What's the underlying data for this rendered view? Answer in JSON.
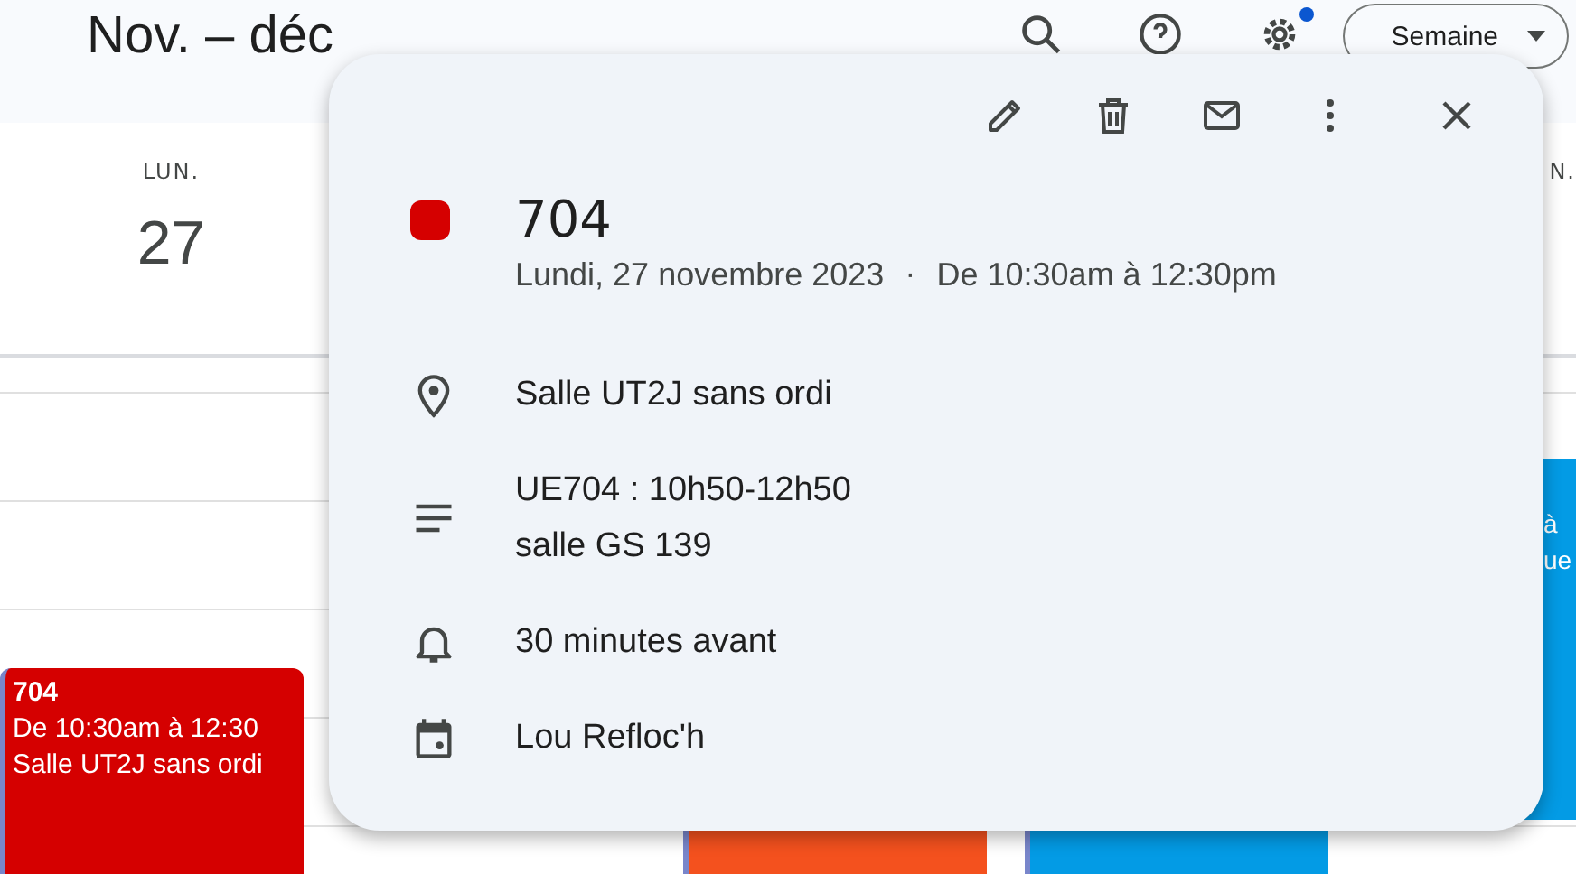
{
  "header": {
    "title": "Nov. – déc",
    "view_button": "Semaine",
    "settings_badge": true
  },
  "day_columns": [
    {
      "weekday": "LUN.",
      "day": "27"
    },
    {
      "weekday": "N."
    }
  ],
  "events": [
    {
      "color": "#d50000",
      "lines": [
        "704",
        "De 10:30am à 12:30",
        "Salle UT2J sans ordi"
      ]
    },
    {
      "color": "#f4511e"
    },
    {
      "color": "#039be5"
    },
    {
      "color": "#039be5",
      "lines": [
        "à",
        "ue"
      ]
    }
  ],
  "popup": {
    "color": "#d50000",
    "title": "704",
    "date": "Lundi, 27 novembre 2023",
    "separator": "·",
    "time": "De 10:30am à 12:30pm",
    "details": [
      {
        "kind": "location",
        "lines": [
          "Salle UT2J sans ordi"
        ]
      },
      {
        "kind": "description",
        "lines": [
          "UE704 : 10h50-12h50",
          "salle GS 139"
        ]
      },
      {
        "kind": "reminder",
        "lines": [
          "30 minutes avant"
        ]
      },
      {
        "kind": "calendar",
        "lines": [
          "Lou Refloc'h"
        ]
      }
    ]
  }
}
